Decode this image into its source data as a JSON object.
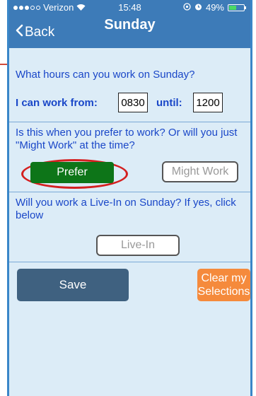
{
  "status_bar": {
    "carrier": "Verizon",
    "time": "15:48",
    "battery": "49%",
    "battery_fraction": 0.49
  },
  "nav": {
    "back_label": "Back",
    "title": "Sunday"
  },
  "hours": {
    "question": "What hours can you work on Sunday?",
    "from_label": "I can work from:",
    "from_value": "0830",
    "until_label": "until:",
    "until_value": "1200"
  },
  "preference": {
    "question": "Is this when you prefer to work? Or will you just \"Might Work\" at the time?",
    "prefer_label": "Prefer",
    "might_work_label": "Might Work"
  },
  "live_in": {
    "question": "Will you work a Live-In on Sunday? If yes, click below",
    "button_label": "Live-In"
  },
  "actions": {
    "save_label": "Save",
    "clear_label_line1": "Clear my",
    "clear_label_line2": "Selections"
  },
  "colors": {
    "header": "#3d7bb8",
    "background": "#dcecf7",
    "question_text": "#1a47c8",
    "prefer_button": "#0d7518",
    "highlight_oval": "#d42020",
    "save_button": "#3f6180",
    "clear_button": "#f58a3c"
  }
}
